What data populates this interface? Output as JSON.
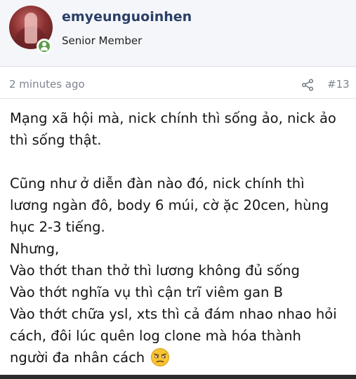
{
  "post": {
    "username": "emyeunguoinhen",
    "user_title": "Senior Member",
    "timestamp": "2 minutes ago",
    "post_number": "#13",
    "content": {
      "line1": "Mạng xã hội mà, nick chính thì sống ảo, nick ảo",
      "line2": "thì sống thật.",
      "line3": "Cũng như ở diễn đàn nào đó, nick chính thì",
      "line4": "lương ngàn đô, body 6 múi, cờ ặc 20cen, hùng",
      "line5": "hục 2-3 tiếng.",
      "line6": "Nhưng,",
      "line7": "Vào thớt than thở thì lương không đủ sống",
      "line8": "Vào thớt nghĩa vụ thì cận trĩ viêm gan B",
      "line9": "Vào thớt chữa ysl, xts thì cả đám nhao nhao hỏi",
      "line10": "cách, đôi lúc quên log clone mà hóa thành",
      "line11": "người đa nhân cách"
    }
  },
  "icons": {
    "share": "share-icon",
    "online": "online-user-icon",
    "emoji": "unamused-face-emoji"
  },
  "colors": {
    "username": "#2a3f66",
    "header_bg": "#f4f6f9",
    "meta_text": "#7d8590",
    "online": "#5a9e45"
  }
}
